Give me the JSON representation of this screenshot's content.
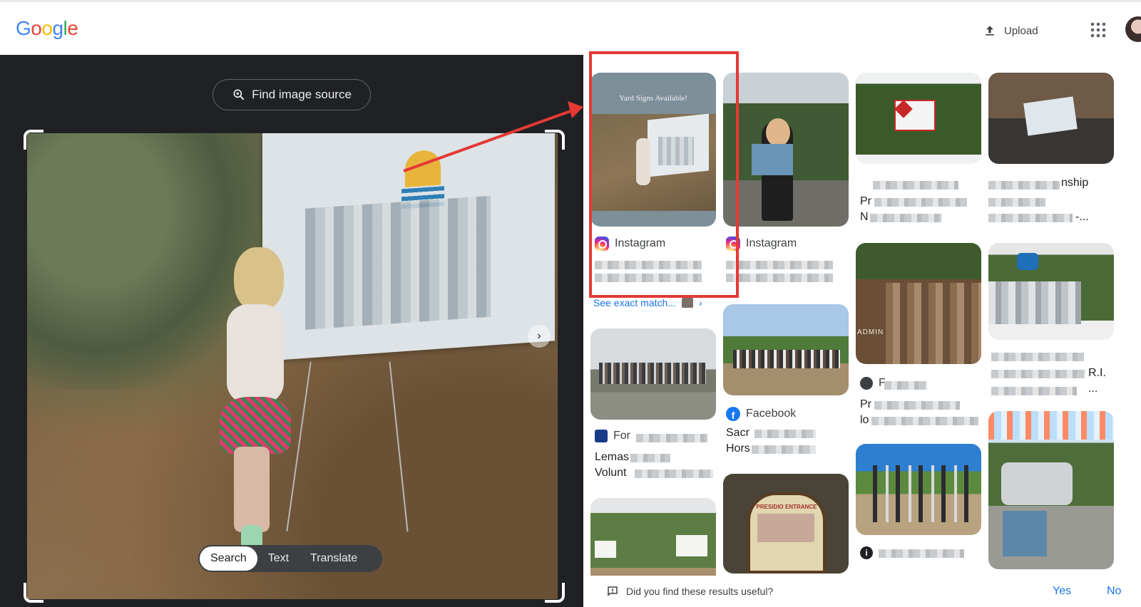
{
  "header": {
    "logo_letters": [
      {
        "ch": "G",
        "color": "#4285f4"
      },
      {
        "ch": "o",
        "color": "#ea4335"
      },
      {
        "ch": "o",
        "color": "#fbbc05"
      },
      {
        "ch": "g",
        "color": "#4285f4"
      },
      {
        "ch": "l",
        "color": "#34a853"
      },
      {
        "ch": "e",
        "color": "#ea4335"
      }
    ],
    "upload_label": "Upload",
    "upload_icon": "upload-icon",
    "apps_icon": "apps-grid-icon"
  },
  "left": {
    "find_source_label": "Find image source",
    "modes": [
      {
        "label": "Search",
        "active": true
      },
      {
        "label": "Text",
        "active": false
      },
      {
        "label": "Translate",
        "active": false
      }
    ]
  },
  "results": {
    "col1": {
      "card1": {
        "source": "Instagram",
        "caption": "Yard Signs Available!",
        "see_exact": "See exact match..."
      },
      "card2": {
        "source": "For",
        "line1": "Lemas",
        "line2": "Volunt"
      }
    },
    "col2": {
      "card1": {
        "source": "Instagram"
      },
      "card2": {
        "source": "Facebook",
        "line1": "Sacr",
        "line2": "Hors"
      },
      "card3": {
        "sign_text": "PRESIDIO ENTRANCE"
      }
    },
    "col3": {
      "card1": {
        "line1": "Pr",
        "line2": "N"
      },
      "card2": {
        "source": "F",
        "line1": "Pr",
        "line2": "lo",
        "sign_text": "ADMIN"
      }
    },
    "col4": {
      "card1": {
        "line1_tail": "nship",
        "line2_tail": "-..."
      },
      "card2": {
        "line_tail": "R.I.",
        "line2_tail": "..."
      }
    }
  },
  "feedback": {
    "question": "Did you find these results useful?",
    "yes": "Yes",
    "no": "No"
  },
  "annotation_color": "#e53935"
}
